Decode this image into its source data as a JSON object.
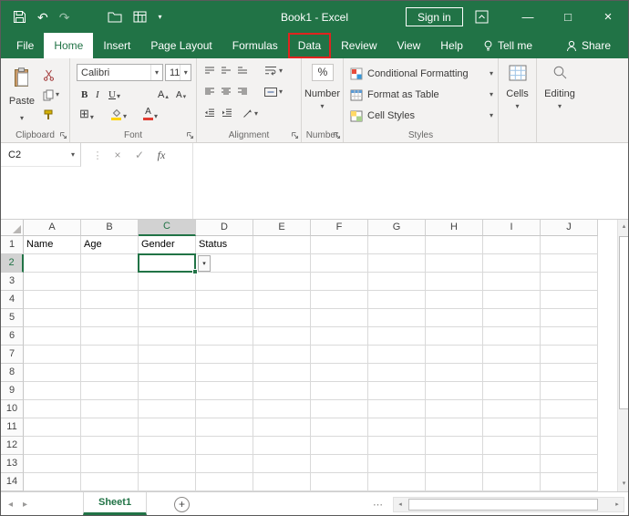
{
  "titlebar": {
    "title": "Book1 - Excel",
    "sign_in_label": "Sign in"
  },
  "tabs": {
    "items": [
      {
        "label": "File"
      },
      {
        "label": "Home"
      },
      {
        "label": "Insert"
      },
      {
        "label": "Page Layout"
      },
      {
        "label": "Formulas"
      },
      {
        "label": "Data"
      },
      {
        "label": "Review"
      },
      {
        "label": "View"
      },
      {
        "label": "Help"
      },
      {
        "label": "Tell me"
      },
      {
        "label": "Share"
      }
    ],
    "active_tab": "Home",
    "highlighted_tab": "Data"
  },
  "ribbon": {
    "group_labels": {
      "clipboard": "Clipboard",
      "font": "Font",
      "alignment": "Alignment",
      "number": "Number",
      "styles": "Styles"
    },
    "clipboard": {
      "paste_label": "Paste"
    },
    "font": {
      "name": "Calibri",
      "size": "11",
      "bold": "B",
      "italic": "I",
      "underline": "U",
      "color_letter": "A",
      "grow_letter": "A",
      "shrink_letter": "A"
    },
    "number": {
      "percent": "%",
      "label": "Number"
    },
    "styles": {
      "conditional_formatting": "Conditional Formatting",
      "format_as_table": "Format as Table",
      "cell_styles": "Cell Styles"
    },
    "cells_label": "Cells",
    "editing_label": "Editing"
  },
  "formula_bar": {
    "name_box": "C2",
    "fx_label": "fx",
    "formula_value": ""
  },
  "grid": {
    "columns": [
      "A",
      "B",
      "C",
      "D",
      "E",
      "F",
      "G",
      "H",
      "I",
      "J"
    ],
    "rows": [
      "1",
      "2",
      "3",
      "4",
      "5",
      "6",
      "7",
      "8",
      "9",
      "10",
      "11",
      "12",
      "13",
      "14"
    ],
    "cells": {
      "A1": "Name",
      "B1": "Age",
      "C1": "Gender",
      "D1": "Status"
    },
    "selected_cell": "C2",
    "selected_column": "C",
    "selected_row": "2"
  },
  "sheet_bar": {
    "sheets": [
      {
        "name": "Sheet1",
        "active": true
      }
    ]
  },
  "icons": {
    "dropdown": "▾",
    "undo": "↶",
    "redo": "↷",
    "minimize": "—",
    "maximize": "□",
    "close": "×",
    "cancel": "×",
    "check": "✓",
    "up_arrow": "▴",
    "down_arrow": "▾",
    "left_arrow": "◂",
    "right_arrow": "▸",
    "dots": "⋯",
    "vdots": "⋮",
    "add": "+",
    "borders": "⊞"
  },
  "colors": {
    "excel_green": "#217346",
    "highlight_red": "#e0231f",
    "selection_border": "#217346"
  }
}
